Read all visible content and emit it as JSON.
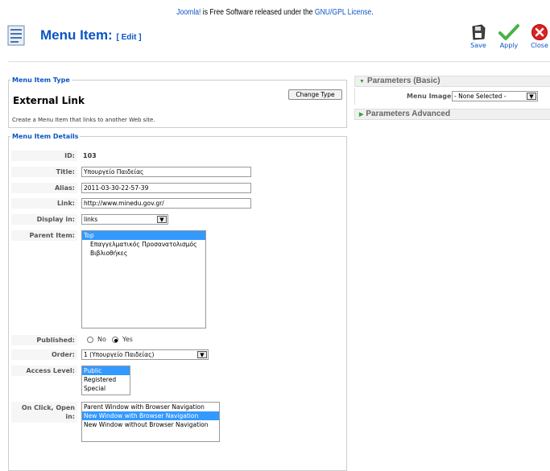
{
  "license": {
    "pre": "Joomla!",
    "mid": " is Free Software released under the ",
    "link": "GNU/GPL License",
    "post": "."
  },
  "toolbar": {
    "title": "Menu Item:",
    "subtitle": "[ Edit ]",
    "save_label": "Save",
    "apply_label": "Apply",
    "close_label": "Close"
  },
  "type_section": {
    "legend": "Menu Item Type",
    "type_name": "External Link",
    "change_button": "Change Type",
    "description": "Create a Menu Item that links to another Web site."
  },
  "details": {
    "legend": "Menu Item Details",
    "id_label": "ID:",
    "id_value": "103",
    "title_label": "Title:",
    "title_value": "Υπουργείο Παιδείας",
    "alias_label": "Alias:",
    "alias_value": "2011-03-30-22-57-39",
    "link_label": "Link:",
    "link_value": "http://www.minedu.gov.gr/",
    "display_label": "Display in:",
    "display_value": "links",
    "parent_label": "Parent Item:",
    "parent_options": [
      {
        "label": "Top",
        "selected": true
      },
      {
        "label": "Επαγγελματικός Προσανατολισμός",
        "selected": false
      },
      {
        "label": "Βιβλιοθήκες",
        "selected": false
      }
    ],
    "published_label": "Published:",
    "published_no": "No",
    "published_yes": "Yes",
    "published_value": "Yes",
    "order_label": "Order:",
    "order_value": "1 (Υπουργείο Παιδείας)",
    "access_label": "Access Level:",
    "access_options": [
      {
        "label": "Public",
        "selected": true
      },
      {
        "label": "Registered",
        "selected": false
      },
      {
        "label": "Special",
        "selected": false
      }
    ],
    "onclick_label_1": "On Click, Open",
    "onclick_label_2": "in:",
    "onclick_options": [
      {
        "label": "Parent Window with Browser Navigation",
        "selected": false
      },
      {
        "label": "New Window with Browser Navigation",
        "selected": true
      },
      {
        "label": "New Window without Browser Navigation",
        "selected": false
      }
    ]
  },
  "params": {
    "basic_title": "Parameters (Basic)",
    "menu_image_label": "Menu Image",
    "menu_image_value": "- None Selected -",
    "advanced_title": "Parameters Advanced"
  },
  "colors": {
    "link": "#0b55c4",
    "selection": "#3399ff",
    "apply_check": "#46b446",
    "close": "#e02020"
  }
}
